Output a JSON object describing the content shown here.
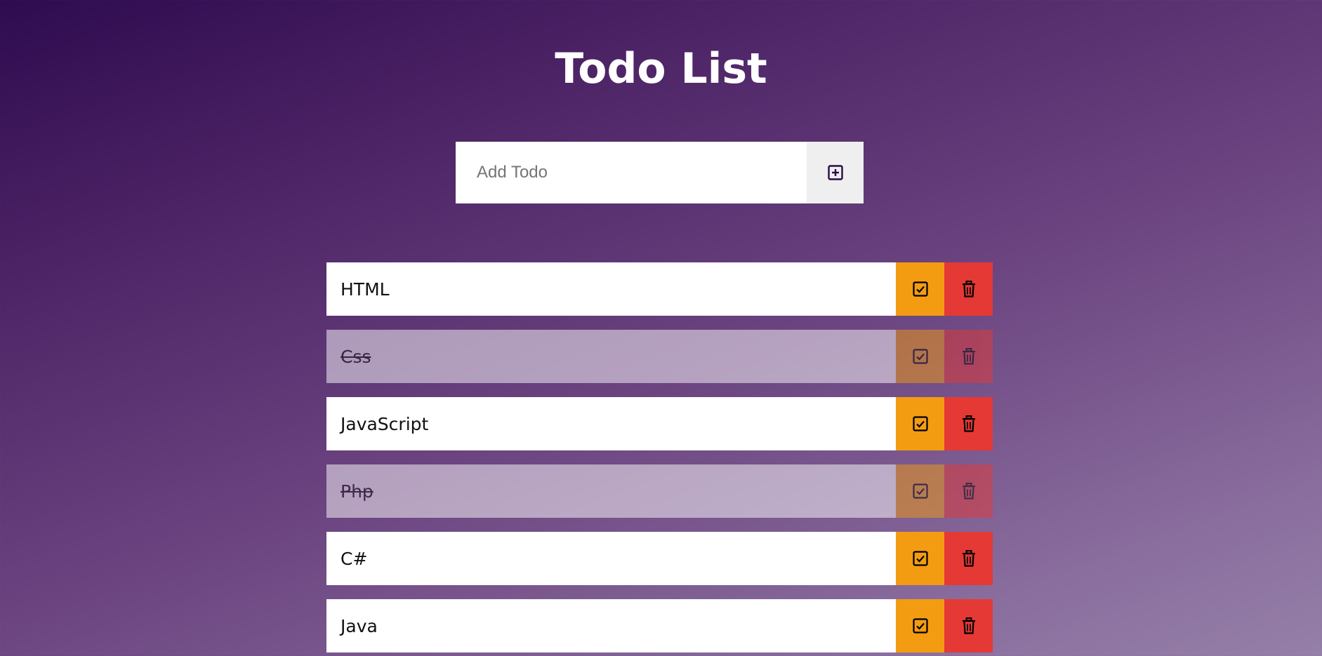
{
  "header": {
    "title": "Todo List"
  },
  "form": {
    "placeholder": "Add Todo",
    "input_value": "",
    "add_icon": "plus-square-icon"
  },
  "todos": [
    {
      "text": "HTML",
      "completed": false
    },
    {
      "text": "Css",
      "completed": true
    },
    {
      "text": "JavaScript",
      "completed": false
    },
    {
      "text": "Php",
      "completed": true
    },
    {
      "text": "C#",
      "completed": false
    },
    {
      "text": "Java",
      "completed": false
    }
  ],
  "icons": {
    "complete": "check-square-icon",
    "delete": "trash-icon"
  },
  "colors": {
    "complete_button": "#f39c12",
    "delete_button": "#e53935",
    "background_start": "#2e0b4f",
    "background_end": "#9580a8"
  }
}
